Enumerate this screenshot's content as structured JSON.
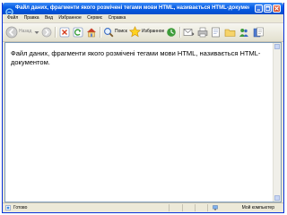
{
  "window": {
    "title": "Файл даних, фрагменти якого розмічені тегами мови HTML, називається HTML-документом"
  },
  "menu": {
    "items": [
      "Файл",
      "Правка",
      "Вид",
      "Избранное",
      "Сервис",
      "Справка"
    ]
  },
  "toolbar": {
    "back_label": "Назад",
    "search_label": "Поиск",
    "favorites_label": "Избранное"
  },
  "document": {
    "text": "Файл даних, фрагменти якого розмічені тегами мови HTML, називається HTML-документом."
  },
  "status": {
    "left_text": "Готово",
    "right_text": "Мой компьютер"
  },
  "colors": {
    "titlebar": "#0a5fe6",
    "chrome": "#ece9d8"
  }
}
